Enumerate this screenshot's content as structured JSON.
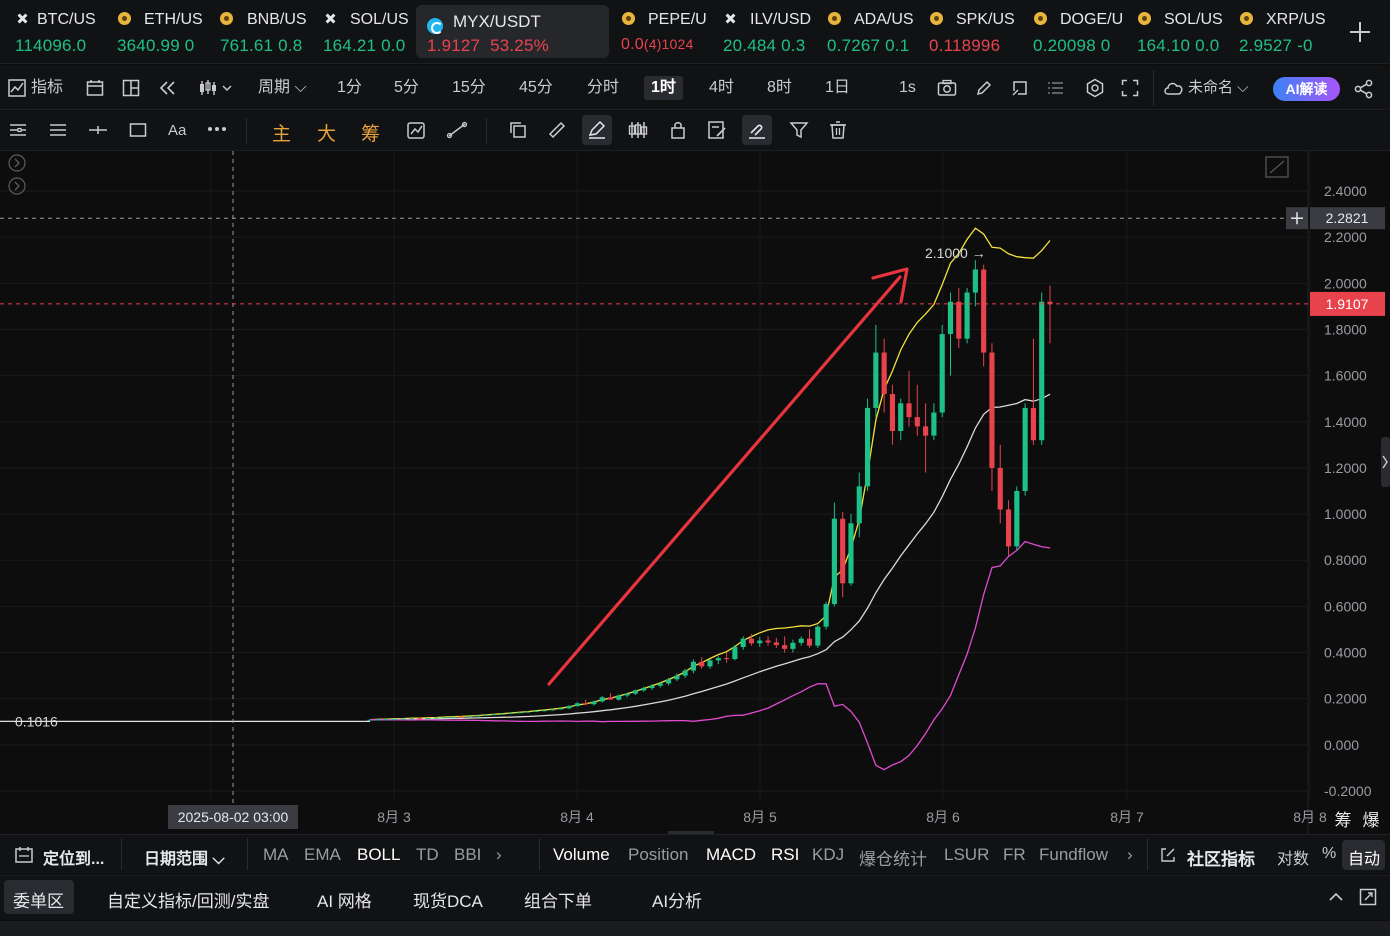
{
  "colors": {
    "up": "#1fbf88",
    "down": "#e8434d",
    "boll_upper": "#f2e23a",
    "boll_mid": "#d9d9d9",
    "boll_lower": "#e04bcf",
    "annotation_arrow": "#e8343d",
    "price_line": "#e8434d"
  },
  "tickers": [
    {
      "symbol": "BTC/US",
      "price": "114096.0",
      "change": "",
      "dir": "up",
      "icon": "cross-icon"
    },
    {
      "symbol": "ETH/US",
      "price": "3640.99",
      "change": "0",
      "dir": "up",
      "icon": "coin-icon"
    },
    {
      "symbol": "BNB/US",
      "price": "761.61",
      "change": "0.8",
      "dir": "up",
      "icon": "coin-icon"
    },
    {
      "symbol": "SOL/US",
      "price": "164.21",
      "change": "0.0",
      "dir": "up",
      "icon": "cross-icon"
    },
    {
      "symbol": "MYX/USDT",
      "price": "1.9127",
      "change": "53.25%",
      "dir": "down",
      "icon": "myx-icon"
    },
    {
      "symbol": "PEPE/U",
      "price": "0.0",
      "change": "(4)1024",
      "dir": "down",
      "icon": "coin-icon"
    },
    {
      "symbol": "ILV/USD",
      "price": "20.484",
      "change": "0.3",
      "dir": "up",
      "icon": "cross-icon"
    },
    {
      "symbol": "ADA/US",
      "price": "0.7267",
      "change": "0.1",
      "dir": "up",
      "icon": "coin-icon"
    },
    {
      "symbol": "SPK/US",
      "price": "0.118996",
      "change": "",
      "dir": "down",
      "icon": "coin-icon"
    },
    {
      "symbol": "DOGE/U",
      "price": "0.20098",
      "change": "0",
      "dir": "up",
      "icon": "coin-icon"
    },
    {
      "symbol": "SOL/US",
      "price": "164.10",
      "change": "0.0",
      "dir": "up",
      "icon": "coin-icon"
    },
    {
      "symbol": "XRP/US",
      "price": "2.9527",
      "change": "-0",
      "dir": "up",
      "icon": "coin-icon"
    }
  ],
  "toolbar": {
    "indicators": "指标",
    "period": "周期",
    "intervals": [
      "1分",
      "5分",
      "15分",
      "45分",
      "分时",
      "1时",
      "4时",
      "8时",
      "1日"
    ],
    "active_interval": "1时",
    "speed": "1s",
    "layout_name": "未命名",
    "ai_read": "AI解读"
  },
  "drawbar": {
    "main": "主",
    "big": "大",
    "chip": "筹",
    "text_tool": "Aa"
  },
  "chart_data": {
    "type": "candlestick",
    "symbol": "MYX/USDT",
    "interval": "1时",
    "y_ticks": [
      "2.4000",
      "2.2000",
      "2.0000",
      "1.8000",
      "1.6000",
      "1.4000",
      "1.2000",
      "1.0000",
      "0.8000",
      "0.6000",
      "0.4000",
      "0.2000",
      "0.000",
      "-0.2000"
    ],
    "ylim": [
      -0.2,
      2.4
    ],
    "x_ticks": [
      "8月 3",
      "8月 4",
      "8月 5",
      "8月 6",
      "8月 7",
      "8月 8"
    ],
    "crosshair_time": "2025-08-02 03:00",
    "crosshair_price": "2.2821",
    "last_price": "1.9107",
    "high_marker": "2.1000",
    "left_marker": "0.1016",
    "overlays": [
      "BOLL upper",
      "BOLL mid",
      "BOLL lower"
    ],
    "candles": [
      [
        0.108,
        0.11,
        0.107,
        0.109
      ],
      [
        0.109,
        0.111,
        0.108,
        0.11
      ],
      [
        0.11,
        0.112,
        0.109,
        0.111
      ],
      [
        0.111,
        0.113,
        0.11,
        0.112
      ],
      [
        0.112,
        0.114,
        0.111,
        0.113
      ],
      [
        0.113,
        0.116,
        0.112,
        0.115
      ],
      [
        0.115,
        0.117,
        0.113,
        0.114
      ],
      [
        0.114,
        0.116,
        0.113,
        0.116
      ],
      [
        0.116,
        0.119,
        0.115,
        0.118
      ],
      [
        0.118,
        0.121,
        0.117,
        0.12
      ],
      [
        0.12,
        0.123,
        0.119,
        0.122
      ],
      [
        0.122,
        0.124,
        0.12,
        0.121
      ],
      [
        0.121,
        0.125,
        0.12,
        0.124
      ],
      [
        0.124,
        0.128,
        0.123,
        0.127
      ],
      [
        0.127,
        0.131,
        0.125,
        0.13
      ],
      [
        0.13,
        0.134,
        0.128,
        0.133
      ],
      [
        0.133,
        0.137,
        0.131,
        0.135
      ],
      [
        0.135,
        0.139,
        0.133,
        0.138
      ],
      [
        0.138,
        0.143,
        0.136,
        0.141
      ],
      [
        0.141,
        0.146,
        0.139,
        0.144
      ],
      [
        0.144,
        0.149,
        0.142,
        0.147
      ],
      [
        0.147,
        0.152,
        0.145,
        0.15
      ],
      [
        0.15,
        0.156,
        0.148,
        0.154
      ],
      [
        0.154,
        0.16,
        0.152,
        0.158
      ],
      [
        0.158,
        0.172,
        0.155,
        0.168
      ],
      [
        0.168,
        0.185,
        0.165,
        0.18
      ],
      [
        0.18,
        0.195,
        0.172,
        0.176
      ],
      [
        0.176,
        0.192,
        0.17,
        0.188
      ],
      [
        0.188,
        0.212,
        0.184,
        0.206
      ],
      [
        0.206,
        0.224,
        0.2,
        0.196
      ],
      [
        0.196,
        0.218,
        0.192,
        0.214
      ],
      [
        0.214,
        0.226,
        0.206,
        0.222
      ],
      [
        0.222,
        0.24,
        0.216,
        0.236
      ],
      [
        0.236,
        0.252,
        0.23,
        0.246
      ],
      [
        0.246,
        0.262,
        0.238,
        0.256
      ],
      [
        0.256,
        0.272,
        0.248,
        0.266
      ],
      [
        0.266,
        0.29,
        0.258,
        0.284
      ],
      [
        0.284,
        0.31,
        0.276,
        0.3
      ],
      [
        0.3,
        0.33,
        0.29,
        0.322
      ],
      [
        0.322,
        0.37,
        0.31,
        0.36
      ],
      [
        0.36,
        0.38,
        0.33,
        0.34
      ],
      [
        0.34,
        0.372,
        0.33,
        0.366
      ],
      [
        0.366,
        0.384,
        0.35,
        0.376
      ],
      [
        0.376,
        0.4,
        0.356,
        0.372
      ],
      [
        0.372,
        0.432,
        0.366,
        0.424
      ],
      [
        0.424,
        0.47,
        0.412,
        0.46
      ],
      [
        0.46,
        0.48,
        0.43,
        0.44
      ],
      [
        0.44,
        0.468,
        0.424,
        0.452
      ],
      [
        0.452,
        0.47,
        0.43,
        0.444
      ],
      [
        0.444,
        0.464,
        0.42,
        0.432
      ],
      [
        0.432,
        0.47,
        0.4,
        0.416
      ],
      [
        0.416,
        0.456,
        0.4,
        0.442
      ],
      [
        0.442,
        0.47,
        0.43,
        0.46
      ],
      [
        0.46,
        0.5,
        0.42,
        0.43
      ],
      [
        0.43,
        0.52,
        0.42,
        0.512
      ],
      [
        0.512,
        0.62,
        0.5,
        0.61
      ],
      [
        0.61,
        1.05,
        0.6,
        0.98
      ],
      [
        0.98,
        1.01,
        0.64,
        0.7
      ],
      [
        0.7,
        1.0,
        0.69,
        0.96
      ],
      [
        0.96,
        1.18,
        0.9,
        1.12
      ],
      [
        1.12,
        1.5,
        1.1,
        1.46
      ],
      [
        1.46,
        1.82,
        1.42,
        1.7
      ],
      [
        1.7,
        1.76,
        1.44,
        1.52
      ],
      [
        1.52,
        1.56,
        1.3,
        1.36
      ],
      [
        1.36,
        1.5,
        1.32,
        1.48
      ],
      [
        1.48,
        1.62,
        1.38,
        1.42
      ],
      [
        1.42,
        1.56,
        1.34,
        1.38
      ],
      [
        1.38,
        1.48,
        1.18,
        1.34
      ],
      [
        1.34,
        1.48,
        1.32,
        1.44
      ],
      [
        1.44,
        1.82,
        1.42,
        1.78
      ],
      [
        1.78,
        1.96,
        1.6,
        1.92
      ],
      [
        1.92,
        1.98,
        1.72,
        1.76
      ],
      [
        1.76,
        1.98,
        1.74,
        1.96
      ],
      [
        1.96,
        2.1,
        1.9,
        2.06
      ],
      [
        2.06,
        2.08,
        1.64,
        1.7
      ],
      [
        1.7,
        1.74,
        1.1,
        1.2
      ],
      [
        1.2,
        1.3,
        0.96,
        1.02
      ],
      [
        1.02,
        1.06,
        0.82,
        0.86
      ],
      [
        0.86,
        1.12,
        0.84,
        1.1
      ],
      [
        1.1,
        1.48,
        1.08,
        1.46
      ],
      [
        1.46,
        1.76,
        1.3,
        1.32
      ],
      [
        1.32,
        1.96,
        1.3,
        1.92
      ],
      [
        1.92,
        1.99,
        1.74,
        1.91
      ]
    ]
  },
  "indicator_bar": {
    "locate": "定位到...",
    "date_range": "日期范围",
    "main_indicators": [
      "MA",
      "EMA",
      "BOLL",
      "TD",
      "BBI"
    ],
    "active_main": "BOLL",
    "sub_indicators": [
      "Volume",
      "Position",
      "MACD",
      "RSI",
      "KDJ",
      "爆仓统计",
      "LSUR",
      "FR",
      "Fundflow"
    ],
    "active_sub": [
      "Volume",
      "MACD",
      "RSI"
    ],
    "community": "社区指标",
    "log": "对数",
    "percent": "%",
    "auto": "自动"
  },
  "bottom_tabs": [
    "委单区",
    "自定义指标/回测/实盘",
    "AI 网格",
    "现货DCA",
    "组合下单",
    "AI分析"
  ]
}
